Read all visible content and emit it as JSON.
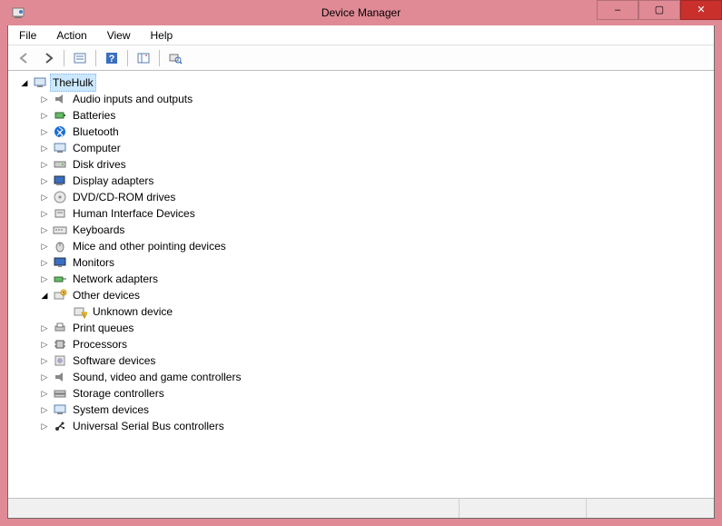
{
  "window": {
    "title": "Device Manager",
    "controls": {
      "min": "–",
      "max": "▢",
      "close": "✕"
    }
  },
  "menu": {
    "file": "File",
    "action": "Action",
    "view": "View",
    "help": "Help"
  },
  "tree": {
    "root": "TheHulk",
    "other_devices": "Other devices",
    "unknown_device": "Unknown device",
    "categories": [
      "Audio inputs and outputs",
      "Batteries",
      "Bluetooth",
      "Computer",
      "Disk drives",
      "Display adapters",
      "DVD/CD-ROM drives",
      "Human Interface Devices",
      "Keyboards",
      "Mice and other pointing devices",
      "Monitors",
      "Network adapters"
    ],
    "categories2": [
      "Print queues",
      "Processors",
      "Software devices",
      "Sound, video and game controllers",
      "Storage controllers",
      "System devices",
      "Universal Serial Bus controllers"
    ]
  }
}
